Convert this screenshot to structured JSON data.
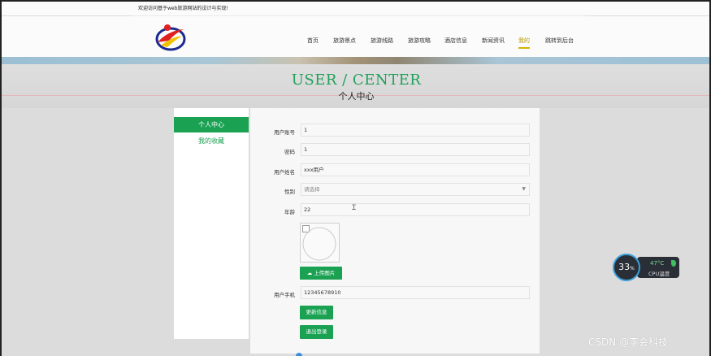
{
  "topbar": {
    "welcome": "欢迎访问基于web旅游网站的设计与实现!"
  },
  "nav": {
    "items": [
      "首页",
      "旅游景点",
      "旅游线路",
      "旅游攻略",
      "酒店信息",
      "新闻资讯",
      "我的",
      "跳转到后台"
    ],
    "active": "我的"
  },
  "page": {
    "title_en": "USER / CENTER",
    "title_zh": "个人中心"
  },
  "sidebar": {
    "items": [
      "个人中心",
      "我的收藏"
    ],
    "active": "个人中心"
  },
  "form": {
    "account_label": "用户账号",
    "account_value": "1",
    "password_label": "密码",
    "password_value": "1",
    "name_label": "用户姓名",
    "name_value": "xxx用户",
    "gender_label": "性别",
    "gender_placeholder": "请选择",
    "age_label": "年龄",
    "age_value": "22",
    "upload_label": "上传图片",
    "phone_label": "用户手机",
    "phone_value": "12345678910",
    "update_label": "更新信息",
    "logout_label": "退出登录"
  },
  "widget": {
    "cpu_percent": "33",
    "percent_sign": "%",
    "temp": "47°C",
    "temp_label": "CPU温度"
  },
  "watermark": "CSDN @李会科技",
  "colors": {
    "accent": "#1aa252",
    "nav_active": "#d6b400",
    "title": "#21a05a"
  }
}
